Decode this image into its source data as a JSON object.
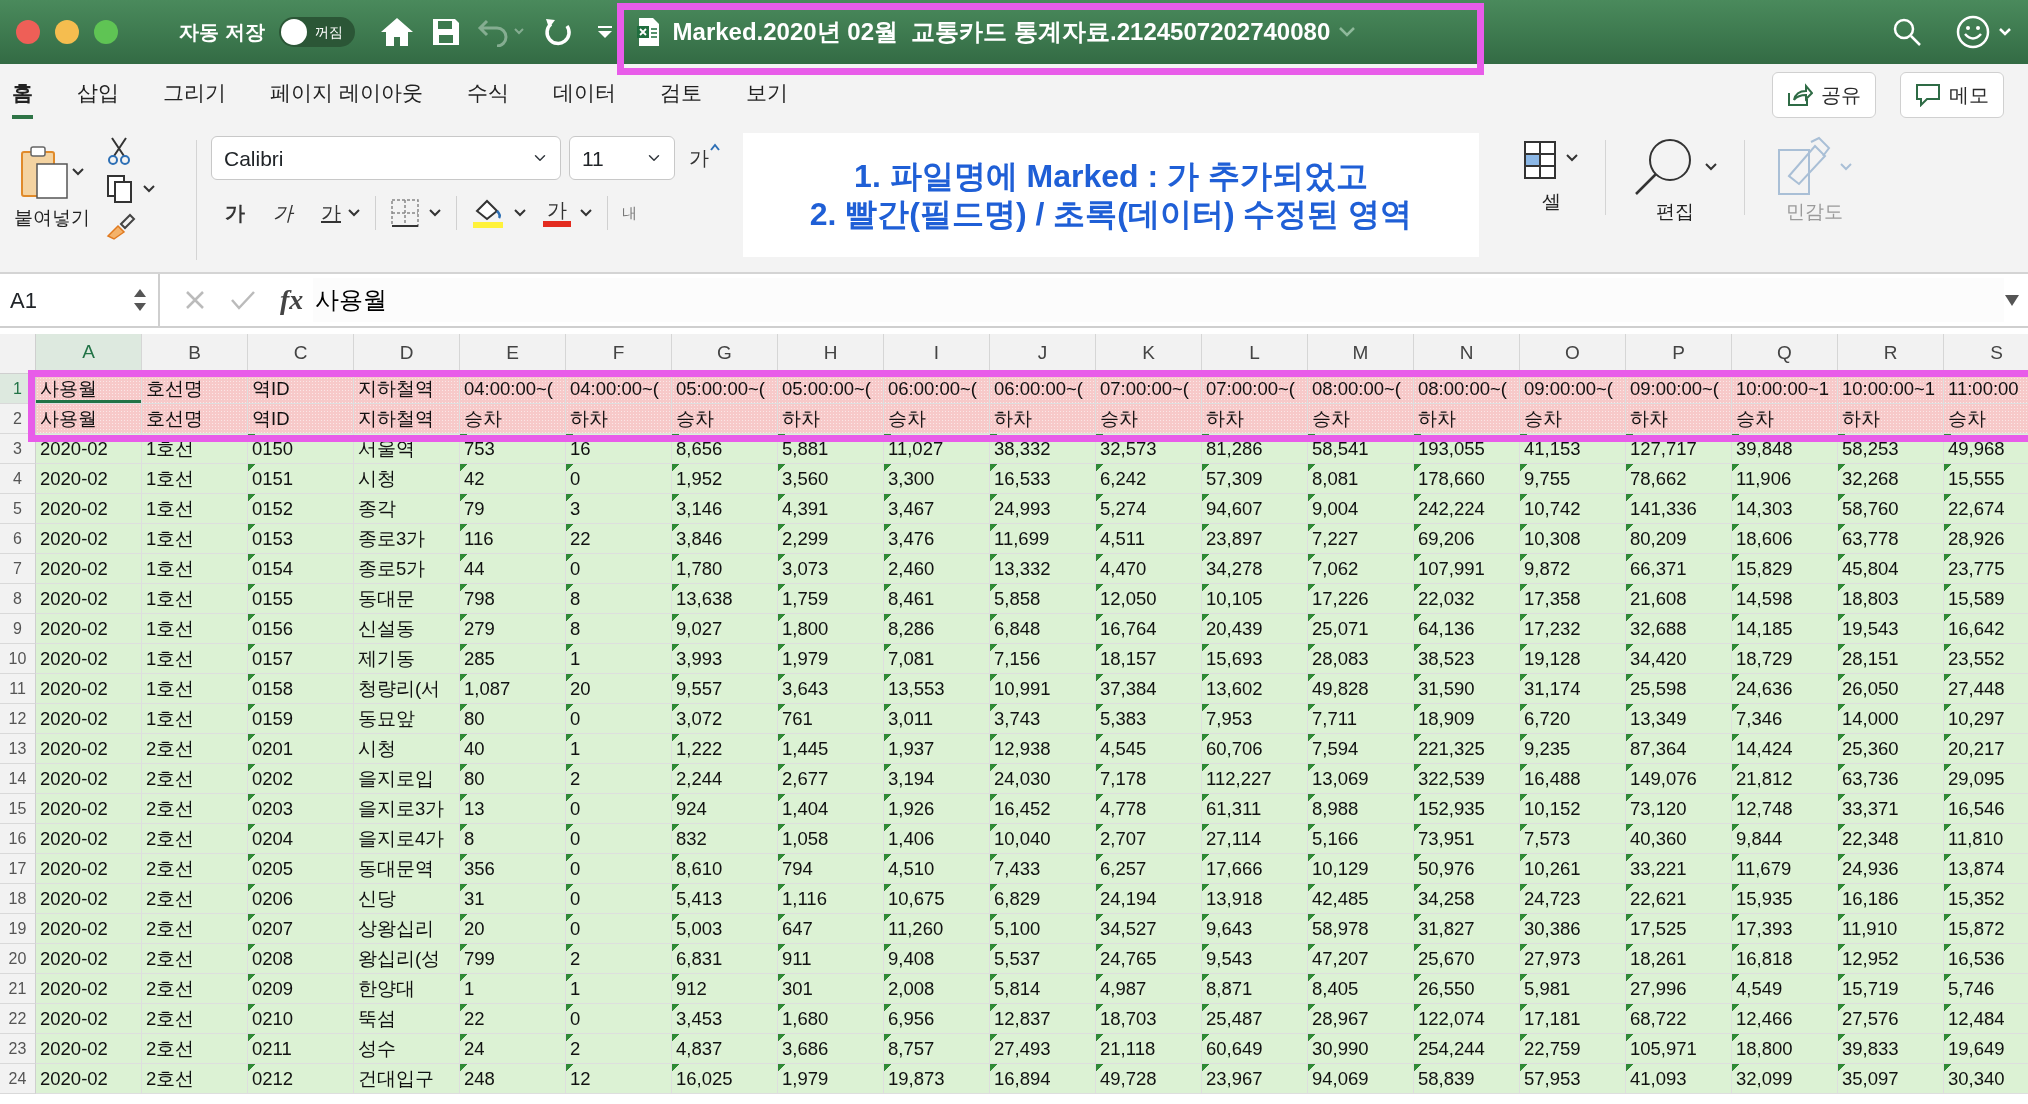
{
  "title_bar": {
    "autosave_label": "자동 저장",
    "autosave_toggle": {
      "label": "꺼짐",
      "on": false
    },
    "undo_disabled": true,
    "file_title": "Marked.2020년 02월  교통카드 통계자료.2124507202740080"
  },
  "ribbon_tabs": [
    {
      "label": "홈",
      "selected": true
    },
    {
      "label": "삽입",
      "selected": false
    },
    {
      "label": "그리기",
      "selected": false
    },
    {
      "label": "페이지 레이아웃",
      "selected": false
    },
    {
      "label": "수식",
      "selected": false
    },
    {
      "label": "데이터",
      "selected": false
    },
    {
      "label": "검토",
      "selected": false
    },
    {
      "label": "보기",
      "selected": false
    }
  ],
  "share_button": "공유",
  "memo_button": "메모",
  "ribbon": {
    "paste_label": "붙여넣기",
    "font_name": "Calibri",
    "font_size": "11",
    "grow_font": "가",
    "bold": "가",
    "italic": "가",
    "underline": "가",
    "font_color": "가",
    "partial_label": "내",
    "cells_label": "셀",
    "editing_label": "편집",
    "sensitivity": {
      "label": "민감도",
      "disabled": true
    }
  },
  "annotation": {
    "lines": [
      "1. 파일명에 Marked : 가 추가되었고",
      "2. 빨간(필드명) / 초록(데이터) 수정된 영역"
    ]
  },
  "formula_bar": {
    "name_box": "A1",
    "function_label": "fx",
    "formula": "사용월"
  },
  "sheet": {
    "columns": [
      {
        "letter": "A",
        "selected": true,
        "flagged": false
      },
      {
        "letter": "B",
        "selected": false,
        "flagged": false
      },
      {
        "letter": "C",
        "selected": false,
        "flagged": true
      },
      {
        "letter": "D",
        "selected": false,
        "flagged": false
      },
      {
        "letter": "E",
        "selected": false,
        "flagged": true
      },
      {
        "letter": "F",
        "selected": false,
        "flagged": true
      },
      {
        "letter": "G",
        "selected": false,
        "flagged": true
      },
      {
        "letter": "H",
        "selected": false,
        "flagged": true
      },
      {
        "letter": "I",
        "selected": false,
        "flagged": true
      },
      {
        "letter": "J",
        "selected": false,
        "flagged": true
      },
      {
        "letter": "K",
        "selected": false,
        "flagged": true
      },
      {
        "letter": "L",
        "selected": false,
        "flagged": true
      },
      {
        "letter": "M",
        "selected": false,
        "flagged": true
      },
      {
        "letter": "N",
        "selected": false,
        "flagged": true
      },
      {
        "letter": "O",
        "selected": false,
        "flagged": true
      },
      {
        "letter": "P",
        "selected": false,
        "flagged": true
      },
      {
        "letter": "Q",
        "selected": false,
        "flagged": true
      },
      {
        "letter": "R",
        "selected": false,
        "flagged": true
      },
      {
        "letter": "S",
        "selected": false,
        "flagged": true
      }
    ],
    "rows": [
      {
        "number": "1",
        "kind": "field",
        "selected": true,
        "cells": [
          "사용월",
          "호선명",
          "역ID",
          "지하철역",
          "04:00:00~(",
          "04:00:00~(",
          "05:00:00~(",
          "05:00:00~(",
          "06:00:00~(",
          "06:00:00~(",
          "07:00:00~(",
          "07:00:00~(",
          "08:00:00~(",
          "08:00:00~(",
          "09:00:00~(",
          "09:00:00~(",
          "10:00:00~1",
          "10:00:00~1",
          "11:00:00"
        ]
      },
      {
        "number": "2",
        "kind": "field",
        "selected": false,
        "cells": [
          "사용월",
          "호선명",
          "역ID",
          "지하철역",
          "승차",
          "하차",
          "승차",
          "하차",
          "승차",
          "하차",
          "승차",
          "하차",
          "승차",
          "하차",
          "승차",
          "하차",
          "승차",
          "하차",
          "승차"
        ]
      },
      {
        "number": "3",
        "kind": "data",
        "selected": false,
        "cells": [
          "2020-02",
          "1호선",
          "0150",
          "서울역",
          "753",
          "16",
          "8,656",
          "5,881",
          "11,027",
          "38,332",
          "32,573",
          "81,286",
          "58,541",
          "193,055",
          "41,153",
          "127,717",
          "39,848",
          "58,253",
          "49,968"
        ]
      },
      {
        "number": "4",
        "kind": "data",
        "selected": false,
        "cells": [
          "2020-02",
          "1호선",
          "0151",
          "시청",
          "42",
          "0",
          "1,952",
          "3,560",
          "3,300",
          "16,533",
          "6,242",
          "57,309",
          "8,081",
          "178,660",
          "9,755",
          "78,662",
          "11,906",
          "32,268",
          "15,555"
        ]
      },
      {
        "number": "5",
        "kind": "data",
        "selected": false,
        "cells": [
          "2020-02",
          "1호선",
          "0152",
          "종각",
          "79",
          "3",
          "3,146",
          "4,391",
          "3,467",
          "24,993",
          "5,274",
          "94,607",
          "9,004",
          "242,224",
          "10,742",
          "141,336",
          "14,303",
          "58,760",
          "22,674"
        ]
      },
      {
        "number": "6",
        "kind": "data",
        "selected": false,
        "cells": [
          "2020-02",
          "1호선",
          "0153",
          "종로3가",
          "116",
          "22",
          "3,846",
          "2,299",
          "3,476",
          "11,699",
          "4,511",
          "23,897",
          "7,227",
          "69,206",
          "10,308",
          "80,209",
          "18,606",
          "63,778",
          "28,926"
        ]
      },
      {
        "number": "7",
        "kind": "data",
        "selected": false,
        "cells": [
          "2020-02",
          "1호선",
          "0154",
          "종로5가",
          "44",
          "0",
          "1,780",
          "3,073",
          "2,460",
          "13,332",
          "4,470",
          "34,278",
          "7,062",
          "107,991",
          "9,872",
          "66,371",
          "15,829",
          "45,804",
          "23,775"
        ]
      },
      {
        "number": "8",
        "kind": "data",
        "selected": false,
        "cells": [
          "2020-02",
          "1호선",
          "0155",
          "동대문",
          "798",
          "8",
          "13,638",
          "1,759",
          "8,461",
          "5,858",
          "12,050",
          "10,105",
          "17,226",
          "22,032",
          "17,358",
          "21,608",
          "14,598",
          "18,803",
          "15,589"
        ]
      },
      {
        "number": "9",
        "kind": "data",
        "selected": false,
        "cells": [
          "2020-02",
          "1호선",
          "0156",
          "신설동",
          "279",
          "8",
          "9,027",
          "1,800",
          "8,286",
          "6,848",
          "16,764",
          "20,439",
          "25,071",
          "64,136",
          "17,232",
          "32,688",
          "14,185",
          "19,543",
          "16,642"
        ]
      },
      {
        "number": "10",
        "kind": "data",
        "selected": false,
        "cells": [
          "2020-02",
          "1호선",
          "0157",
          "제기동",
          "285",
          "1",
          "3,993",
          "1,979",
          "7,081",
          "7,156",
          "18,157",
          "15,693",
          "28,083",
          "38,523",
          "19,128",
          "34,420",
          "18,729",
          "28,151",
          "23,552"
        ]
      },
      {
        "number": "11",
        "kind": "data",
        "selected": false,
        "cells": [
          "2020-02",
          "1호선",
          "0158",
          "청량리(서",
          "1,087",
          "20",
          "9,557",
          "3,643",
          "13,553",
          "10,991",
          "37,384",
          "13,602",
          "49,828",
          "31,590",
          "31,174",
          "25,598",
          "24,636",
          "26,050",
          "27,448"
        ]
      },
      {
        "number": "12",
        "kind": "data",
        "selected": false,
        "cells": [
          "2020-02",
          "1호선",
          "0159",
          "동묘앞",
          "80",
          "0",
          "3,072",
          "761",
          "3,011",
          "3,743",
          "5,383",
          "7,953",
          "7,711",
          "18,909",
          "6,720",
          "13,349",
          "7,346",
          "14,000",
          "10,297"
        ]
      },
      {
        "number": "13",
        "kind": "data",
        "selected": false,
        "cells": [
          "2020-02",
          "2호선",
          "0201",
          "시청",
          "40",
          "1",
          "1,222",
          "1,445",
          "1,937",
          "12,938",
          "4,545",
          "60,706",
          "7,594",
          "221,325",
          "9,235",
          "87,364",
          "14,424",
          "25,360",
          "20,217"
        ]
      },
      {
        "number": "14",
        "kind": "data",
        "selected": false,
        "cells": [
          "2020-02",
          "2호선",
          "0202",
          "을지로입",
          "80",
          "2",
          "2,244",
          "2,677",
          "3,194",
          "24,030",
          "7,178",
          "112,227",
          "13,069",
          "322,539",
          "16,488",
          "149,076",
          "21,812",
          "63,736",
          "29,095"
        ]
      },
      {
        "number": "15",
        "kind": "data",
        "selected": false,
        "cells": [
          "2020-02",
          "2호선",
          "0203",
          "을지로3가",
          "13",
          "0",
          "924",
          "1,404",
          "1,926",
          "16,452",
          "4,778",
          "61,311",
          "8,988",
          "152,935",
          "10,152",
          "73,120",
          "12,748",
          "33,371",
          "16,546"
        ]
      },
      {
        "number": "16",
        "kind": "data",
        "selected": false,
        "cells": [
          "2020-02",
          "2호선",
          "0204",
          "을지로4가",
          "8",
          "0",
          "832",
          "1,058",
          "1,406",
          "10,040",
          "2,707",
          "27,114",
          "5,166",
          "73,951",
          "7,573",
          "40,360",
          "9,844",
          "22,348",
          "11,810"
        ]
      },
      {
        "number": "17",
        "kind": "data",
        "selected": false,
        "cells": [
          "2020-02",
          "2호선",
          "0205",
          "동대문역",
          "356",
          "0",
          "8,610",
          "794",
          "4,510",
          "7,433",
          "6,257",
          "17,666",
          "10,129",
          "50,976",
          "10,261",
          "33,221",
          "11,679",
          "24,936",
          "13,874"
        ]
      },
      {
        "number": "18",
        "kind": "data",
        "selected": false,
        "cells": [
          "2020-02",
          "2호선",
          "0206",
          "신당",
          "31",
          "0",
          "5,413",
          "1,116",
          "10,675",
          "6,829",
          "24,194",
          "13,918",
          "42,485",
          "34,258",
          "24,723",
          "22,621",
          "15,935",
          "16,186",
          "15,352"
        ]
      },
      {
        "number": "19",
        "kind": "data",
        "selected": false,
        "cells": [
          "2020-02",
          "2호선",
          "0207",
          "상왕십리",
          "20",
          "0",
          "5,003",
          "647",
          "11,260",
          "5,100",
          "34,527",
          "9,643",
          "58,978",
          "31,827",
          "30,386",
          "17,525",
          "17,393",
          "11,910",
          "15,872"
        ]
      },
      {
        "number": "20",
        "kind": "data",
        "selected": false,
        "cells": [
          "2020-02",
          "2호선",
          "0208",
          "왕십리(성",
          "799",
          "2",
          "6,831",
          "911",
          "9,408",
          "5,537",
          "24,765",
          "9,543",
          "47,207",
          "25,670",
          "27,973",
          "18,261",
          "16,818",
          "12,952",
          "16,536"
        ]
      },
      {
        "number": "21",
        "kind": "data",
        "selected": false,
        "cells": [
          "2020-02",
          "2호선",
          "0209",
          "한양대",
          "1",
          "1",
          "912",
          "301",
          "2,008",
          "5,814",
          "4,987",
          "8,871",
          "8,405",
          "26,550",
          "5,981",
          "27,996",
          "4,549",
          "15,719",
          "5,746"
        ]
      },
      {
        "number": "22",
        "kind": "data",
        "selected": false,
        "cells": [
          "2020-02",
          "2호선",
          "0210",
          "뚝섬",
          "22",
          "0",
          "3,453",
          "1,680",
          "6,956",
          "12,837",
          "18,703",
          "25,487",
          "28,967",
          "122,074",
          "17,181",
          "68,722",
          "12,466",
          "27,576",
          "12,484"
        ]
      },
      {
        "number": "23",
        "kind": "data",
        "selected": false,
        "cells": [
          "2020-02",
          "2호선",
          "0211",
          "성수",
          "24",
          "2",
          "4,837",
          "3,686",
          "8,757",
          "27,493",
          "21,118",
          "60,649",
          "30,990",
          "254,244",
          "22,759",
          "105,971",
          "18,800",
          "39,833",
          "19,649"
        ]
      },
      {
        "number": "24",
        "kind": "data",
        "selected": false,
        "cells": [
          "2020-02",
          "2호선",
          "0212",
          "건대입구",
          "248",
          "12",
          "16,025",
          "1,979",
          "19,873",
          "16,894",
          "49,728",
          "23,967",
          "94,069",
          "58,839",
          "57,953",
          "41,093",
          "32,099",
          "35,097",
          "30,340"
        ]
      }
    ]
  }
}
